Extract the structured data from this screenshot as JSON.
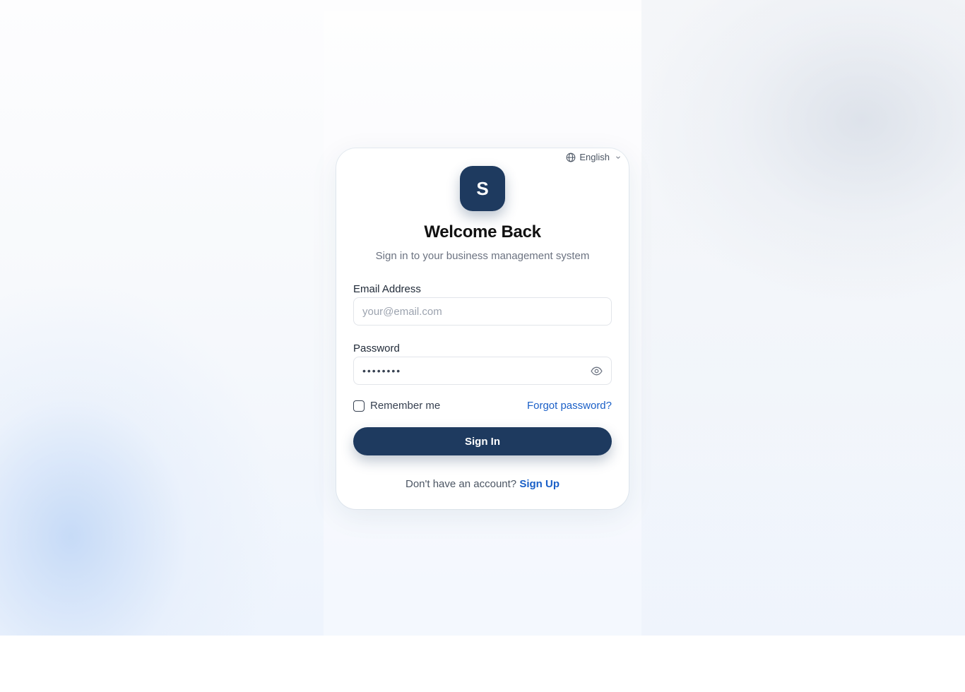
{
  "language": {
    "selected": "English",
    "icon": "globe-icon",
    "chevron": "chevron-down-icon"
  },
  "brand": {
    "logo_letter": "S",
    "color": "#1e3a5f"
  },
  "header": {
    "title": "Welcome Back",
    "subtitle": "Sign in to your business management system"
  },
  "form": {
    "email_label": "Email Address",
    "email_placeholder": "your@email.com",
    "email_value": "",
    "password_label": "Password",
    "password_value": "••••••••",
    "password_toggle_icon": "eye-icon",
    "remember_label": "Remember me",
    "remember_checked": false,
    "forgot_label": "Forgot password?",
    "submit_label": "Sign In"
  },
  "footer": {
    "prompt": "Don't have an account?",
    "signup_label": "Sign Up"
  },
  "colors": {
    "accent": "#1e3a5f",
    "link": "#1a5fc7"
  }
}
